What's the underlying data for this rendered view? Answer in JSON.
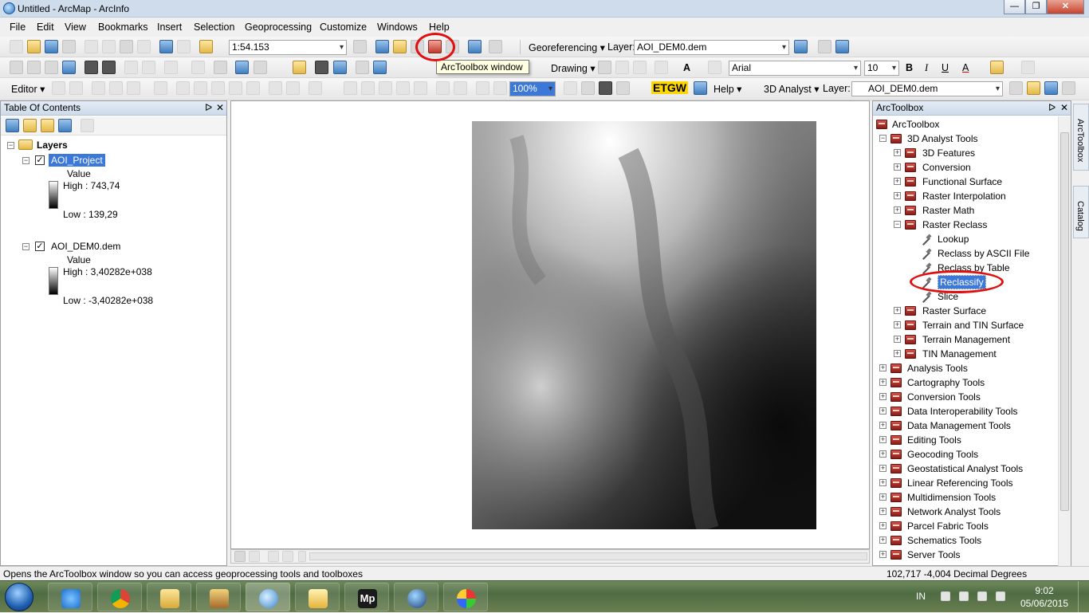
{
  "window": {
    "title": "Untitled - ArcMap - ArcInfo",
    "btn_min": "—",
    "btn_max": "❐",
    "btn_close": "✕"
  },
  "menu": [
    "File",
    "Edit",
    "View",
    "Bookmarks",
    "Insert",
    "Selection",
    "Geoprocessing",
    "Customize",
    "Windows",
    "Help"
  ],
  "toolbar1": {
    "scale": "1:54.153",
    "georef_label": "Georeferencing ▾",
    "layer_label": "Layer:",
    "layer_value": "AOI_DEM0.dem"
  },
  "toolbar2": {
    "drawing_label": "Drawing ▾",
    "font_value": "Arial",
    "size_value": "10",
    "bold": "B",
    "italic": "I",
    "underline": "U",
    "text_a": "A"
  },
  "toolbar3": {
    "editor_label": "Editor ▾",
    "zoom_pct": "100%",
    "etgw": "ETGW",
    "help_label": "Help ▾",
    "analyst_label": "3D Analyst ▾",
    "layer_label": "Layer:",
    "layer_value": "AOI_DEM0.dem"
  },
  "tooltip": "ArcToolbox window",
  "toc": {
    "title": "Table Of Contents",
    "pin": "ᐅ",
    "close": "✕",
    "layers_label": "Layers",
    "layers": [
      {
        "name": "AOI_Project",
        "value": "Value",
        "high": "High : 743,74",
        "low": "Low : 139,29"
      },
      {
        "name": "AOI_DEM0.dem",
        "value": "Value",
        "high": "High : 3,40282e+038",
        "low": "Low : -3,40282e+038"
      }
    ]
  },
  "arctoolbox": {
    "title": "ArcToolbox",
    "pin": "ᐅ",
    "close": "✕",
    "root": "ArcToolbox",
    "analyst3d": "3D Analyst Tools",
    "sub3d": [
      "3D Features",
      "Conversion",
      "Functional Surface",
      "Raster Interpolation",
      "Raster Math",
      "Raster Reclass"
    ],
    "reclass_tools": [
      "Lookup",
      "Reclass by ASCII File",
      "Reclass by Table",
      "Reclassify",
      "Slice"
    ],
    "sub3d_after": [
      "Raster Surface",
      "Terrain and TIN Surface",
      "Terrain Management",
      "TIN Management"
    ],
    "toolboxes": [
      "Analysis Tools",
      "Cartography Tools",
      "Conversion Tools",
      "Data Interoperability Tools",
      "Data Management Tools",
      "Editing Tools",
      "Geocoding Tools",
      "Geostatistical Analyst Tools",
      "Linear Referencing Tools",
      "Multidimension Tools",
      "Network Analyst Tools",
      "Parcel Fabric Tools",
      "Schematics Tools",
      "Server Tools"
    ]
  },
  "side_tabs": [
    "ArcToolbox",
    "Catalog"
  ],
  "status": {
    "message": "Opens the ArcToolbox window so you can access geoprocessing tools and toolboxes",
    "coords": "102,717  -4,004 Decimal Degrees"
  },
  "taskbar": {
    "lang": "IN",
    "time": "9:02",
    "date": "05/06/2015",
    "mp_label": "Mp"
  }
}
